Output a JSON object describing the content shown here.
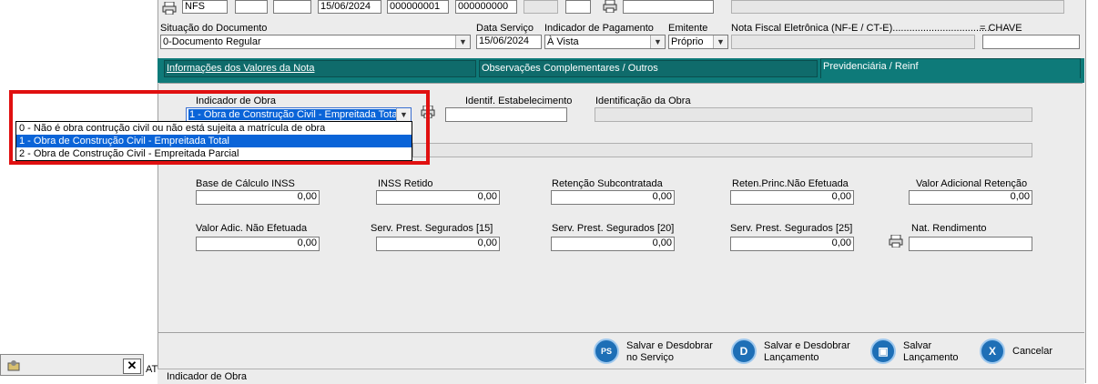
{
  "top_row": {
    "model": "NFS",
    "serie": "",
    "subserie": "",
    "date": "15/06/2024",
    "number1": "000000001",
    "number2": "000000000"
  },
  "header": {
    "situacao_label": "Situação do Documento",
    "situacao_value": "0-Documento Regular",
    "data_servico_label": "Data Serviço",
    "data_servico_value": "15/06/2024",
    "indicador_pagamento_label": "Indicador de Pagamento",
    "indicador_pagamento_value": "À Vista",
    "emitente_label": "Emitente",
    "emitente_value": "Próprio",
    "nfe_label": "Nota Fiscal Eletrônica (NF-E / CT-E)...................................",
    "chave_label": "= CHAVE",
    "nfe_value": "",
    "chave_value": ""
  },
  "tabs": [
    {
      "label": "Informações dos Valores da Nota"
    },
    {
      "label": "Observações Complementares / Outros"
    },
    {
      "label": "Previdenciária / Reinf"
    }
  ],
  "reinf": {
    "indicador_obra_label": "Indicador de Obra",
    "indicador_obra_value": "1 - Obra de Construção Civil - Empreitada Total",
    "identif_estab_label": "Identif. Estabelecimento",
    "identif_estab_value": "",
    "identif_obra_label": "Identificação da Obra",
    "identif_obra_value": "",
    "dropdown_options": [
      "0 - Não é obra contrução civil ou não está sujeita a matrícula de obra",
      "1 - Obra de Construção Civil - Empreitada Total",
      "2 - Obra de Construção Civil - Empreitada Parcial"
    ],
    "selected_index": 1
  },
  "values_row1": [
    {
      "label": "Base de Cálculo INSS",
      "value": "0,00"
    },
    {
      "label": "INSS Retido",
      "value": "0,00"
    },
    {
      "label": "Retenção Subcontratada",
      "value": "0,00"
    },
    {
      "label": "Reten.Princ.Não Efetuada",
      "value": "0,00"
    },
    {
      "label": "Valor Adicional Retenção",
      "value": "0,00"
    }
  ],
  "values_row2": [
    {
      "label": "Valor Adic. Não Efetuada",
      "value": "0,00"
    },
    {
      "label": "Serv. Prest. Segurados [15]",
      "value": "0,00"
    },
    {
      "label": "Serv. Prest. Segurados [20]",
      "value": "0,00"
    },
    {
      "label": "Serv. Prest. Segurados [25]",
      "value": "0,00"
    },
    {
      "label": "Nat. Rendimento",
      "value": ""
    }
  ],
  "buttons": {
    "salvar_desdobrar_servico_1": "Salvar e Desdobrar",
    "salvar_desdobrar_servico_2": "no Serviço",
    "salvar_desdobrar_servico_icon": "PS",
    "salvar_desdobrar_lanc_1": "Salvar e Desdobrar",
    "salvar_desdobrar_lanc_2": "Lançamento",
    "salvar_desdobrar_lanc_icon": "D",
    "salvar_lanc_1": "Salvar",
    "salvar_lanc_2": "Lançamento",
    "cancelar": "Cancelar"
  },
  "status_bar": {
    "text": "Indicador de Obra",
    "left_at": "AT"
  },
  "icons": {
    "printer": "printer-icon",
    "close": "close-icon",
    "taskbar": "app-icon"
  },
  "colors": {
    "tab_teal": "#0f6b6b",
    "selection_blue": "#0a64d8",
    "highlight_red": "#e01010",
    "button_blue": "#1e6fb6"
  }
}
